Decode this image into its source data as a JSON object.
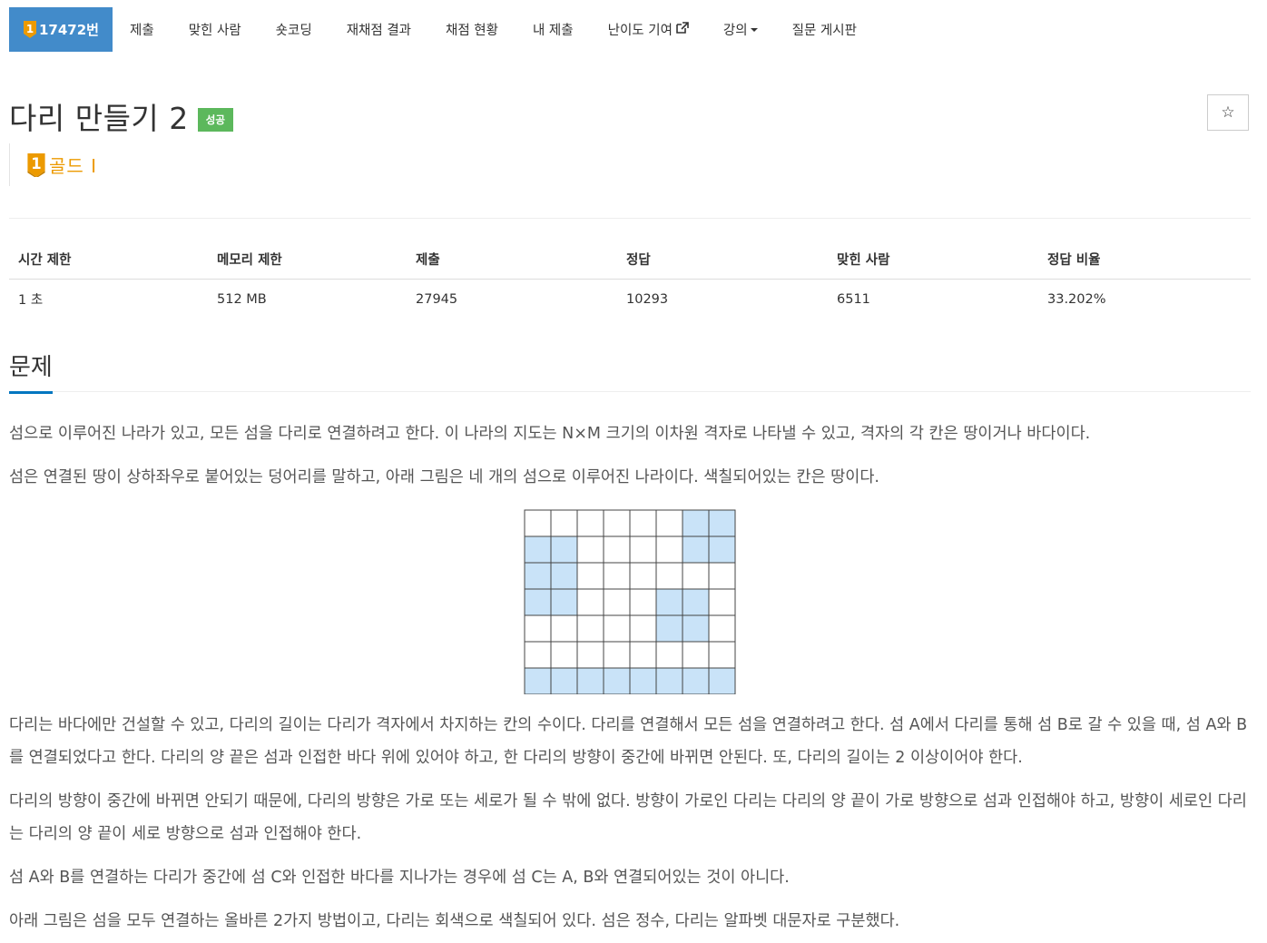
{
  "nav": {
    "problem_number": "17472번",
    "tabs": [
      "제출",
      "맞힌 사람",
      "숏코딩",
      "재채점 결과",
      "채점 현황",
      "내 제출"
    ],
    "contribute_label": "난이도 기여",
    "lecture_label": "강의",
    "board_label": "질문 게시판",
    "badge_color": "#ec9a00",
    "badge_digit": "1"
  },
  "problem": {
    "title": "다리 만들기 2",
    "status": "성공",
    "tier": "골드 I",
    "star_icon": "☆"
  },
  "stats": {
    "headers": [
      "시간 제한",
      "메모리 제한",
      "제출",
      "정답",
      "맞힌 사람",
      "정답 비율"
    ],
    "values": [
      "1 초",
      "512 MB",
      "27945",
      "10293",
      "6511",
      "33.202%"
    ]
  },
  "section": {
    "title": "문제"
  },
  "paragraphs": {
    "p1": "섬으로 이루어진 나라가 있고, 모든 섬을 다리로 연결하려고 한다. 이 나라의 지도는 N×M 크기의 이차원 격자로 나타낼 수 있고, 격자의 각 칸은 땅이거나 바다이다.",
    "p2": "섬은 연결된 땅이 상하좌우로 붙어있는 덩어리를 말하고, 아래 그림은 네 개의 섬으로 이루어진 나라이다. 색칠되어있는 칸은 땅이다.",
    "p3": "다리는 바다에만 건설할 수 있고, 다리의 길이는 다리가 격자에서 차지하는 칸의 수이다. 다리를 연결해서 모든 섬을 연결하려고 한다. 섬 A에서 다리를 통해 섬 B로 갈 수 있을 때, 섬 A와 B를 연결되었다고 한다. 다리의 양 끝은 섬과 인접한 바다 위에 있어야 하고, 한 다리의 방향이 중간에 바뀌면 안된다. 또, 다리의 길이는 2 이상이어야 한다.",
    "p4": "다리의 방향이 중간에 바뀌면 안되기 때문에, 다리의 방향은 가로 또는 세로가 될 수 밖에 없다. 방향이 가로인 다리는 다리의 양 끝이 가로 방향으로 섬과 인접해야 하고, 방향이 세로인 다리는 다리의 양 끝이 세로 방향으로 섬과 인접해야 한다.",
    "p5": "섬 A와 B를 연결하는 다리가 중간에 섬 C와 인접한 바다를 지나가는 경우에 섬 C는 A, B와 연결되어있는 것이 아니다.",
    "p6": "아래 그림은 섬을 모두 연결하는 올바른 2가지 방법이고, 다리는 회색으로 색칠되어 있다. 섬은 정수, 다리는 알파벳 대문자로 구분했다."
  },
  "map_grid": {
    "land_color": "#c9e3f8",
    "sea_color": "#ffffff",
    "rows": [
      [
        0,
        0,
        0,
        0,
        0,
        0,
        1,
        1
      ],
      [
        1,
        1,
        0,
        0,
        0,
        0,
        1,
        1
      ],
      [
        1,
        1,
        0,
        0,
        0,
        0,
        0,
        0
      ],
      [
        1,
        1,
        0,
        0,
        0,
        1,
        1,
        0
      ],
      [
        0,
        0,
        0,
        0,
        0,
        1,
        1,
        0
      ],
      [
        0,
        0,
        0,
        0,
        0,
        0,
        0,
        0
      ],
      [
        1,
        1,
        1,
        1,
        1,
        1,
        1,
        1
      ]
    ]
  }
}
